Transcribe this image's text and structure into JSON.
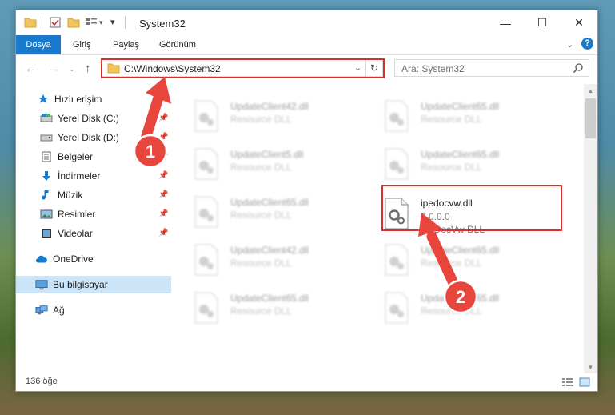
{
  "window": {
    "title": "System32",
    "controls": {
      "minimize": "—",
      "maximize": "☐",
      "close": "✕"
    }
  },
  "ribbon": {
    "tabs": [
      {
        "label": "Dosya"
      },
      {
        "label": "Giriş"
      },
      {
        "label": "Paylaş"
      },
      {
        "label": "Görünüm"
      }
    ],
    "help": "?"
  },
  "address": {
    "path": "C:\\Windows\\System32",
    "search_placeholder": "Ara: System32"
  },
  "nav": {
    "items": [
      {
        "label": "Hızlı erişim",
        "icon": "star-icon"
      },
      {
        "label": "Yerel Disk (C:)",
        "icon": "drive-icon",
        "pinned": true
      },
      {
        "label": "Yerel Disk (D:)",
        "icon": "drive-icon",
        "pinned": true
      },
      {
        "label": "Belgeler",
        "icon": "document-icon",
        "pinned": true
      },
      {
        "label": "İndirmeler",
        "icon": "download-icon",
        "pinned": true
      },
      {
        "label": "Müzik",
        "icon": "music-icon",
        "pinned": true
      },
      {
        "label": "Resimler",
        "icon": "pictures-icon",
        "pinned": true
      },
      {
        "label": "Videolar",
        "icon": "video-icon",
        "pinned": true
      },
      {
        "label": "OneDrive",
        "icon": "cloud-icon"
      },
      {
        "label": "Bu bilgisayar",
        "icon": "computer-icon",
        "selected": true
      },
      {
        "label": "Ağ",
        "icon": "network-icon"
      }
    ]
  },
  "files": [
    {
      "name": "UpdateClient42.dll",
      "desc": "Resource DLL"
    },
    {
      "name": "UpdateClient65.dll",
      "desc": "Resource DLL"
    },
    {
      "name": "UpdateClient5.dll",
      "desc": "Resource DLL"
    },
    {
      "name": "UpdateClient65.dll",
      "desc": "Resource DLL"
    },
    {
      "name": "UpdateClient65.dll",
      "desc": "Resource DLL"
    },
    {
      "name": "ipedocvw.dll",
      "version": "7.0.0.0",
      "desc": "IpeDocVw DLL",
      "highlighted": true
    },
    {
      "name": "UpdateClient42.dll",
      "desc": "Resource DLL"
    },
    {
      "name": "UpdateClient65.dll",
      "desc": "Resource DLL"
    },
    {
      "name": "UpdateClient65.dll",
      "desc": "Resource DLL"
    },
    {
      "name": "UpdateClient65.dll",
      "desc": "Resource DLL"
    }
  ],
  "status": {
    "count": "136 öğe"
  },
  "annotations": [
    {
      "label": "1"
    },
    {
      "label": "2"
    }
  ],
  "colors": {
    "accent": "#1979ca",
    "highlight": "#d9302f",
    "selected": "#cce4f7"
  }
}
